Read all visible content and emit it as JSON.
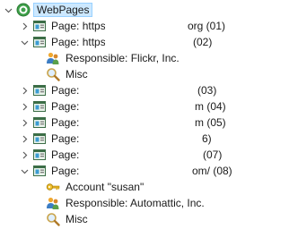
{
  "tree": {
    "root": {
      "label": "WebPages",
      "icon": "globe-icon"
    },
    "pages": [
      {
        "prefix": "Page: https",
        "suffix": "org (01)",
        "expanded": false
      },
      {
        "prefix": "Page: https",
        "suffix": "(02)",
        "expanded": true,
        "children": [
          {
            "icon": "people-icon",
            "label": "Responsible: Flickr, Inc."
          },
          {
            "icon": "magnifier-icon",
            "label": "Misc"
          }
        ]
      },
      {
        "prefix": "Page:",
        "suffix": "(03)",
        "expanded": false
      },
      {
        "prefix": "Page:",
        "suffix": "m (04)",
        "expanded": false
      },
      {
        "prefix": "Page:",
        "suffix": "m (05)",
        "expanded": false
      },
      {
        "prefix": "Page:",
        "suffix": "6)",
        "expanded": false
      },
      {
        "prefix": "Page:",
        "suffix": "(07)",
        "expanded": false
      },
      {
        "prefix": "Page:",
        "suffix": "om/ (08)",
        "expanded": true,
        "children": [
          {
            "icon": "key-icon",
            "label": "Account \"susan\""
          },
          {
            "icon": "people-icon",
            "label": "Responsible: Automattic, Inc."
          },
          {
            "icon": "magnifier-icon",
            "label": "Misc"
          }
        ]
      }
    ]
  },
  "colors": {
    "selection_bg": "#cce8ff",
    "selection_border": "#99d1ff",
    "twisty": "#5a5a5a"
  }
}
